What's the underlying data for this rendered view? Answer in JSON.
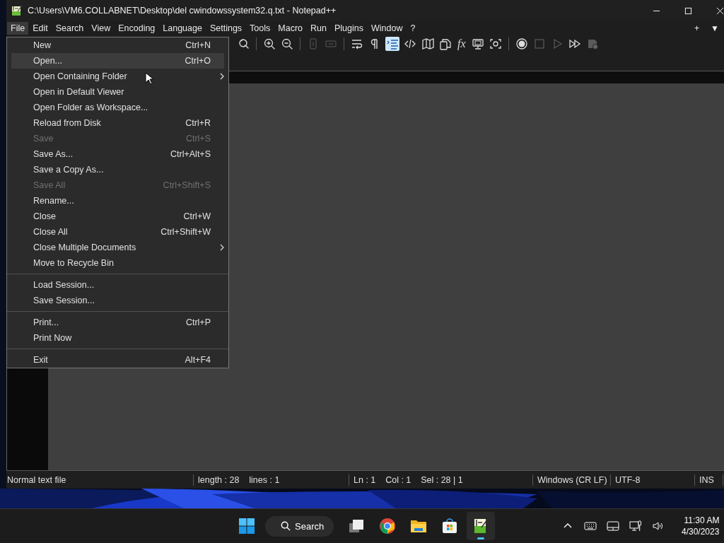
{
  "window": {
    "title": "C:\\Users\\VM6.COLLABNET\\Desktop\\del cwindowssystem32.q.txt - Notepad++"
  },
  "menu_bar": [
    {
      "label": "File",
      "selected": true
    },
    {
      "label": "Edit",
      "selected": false
    },
    {
      "label": "Search",
      "selected": false
    },
    {
      "label": "View",
      "selected": false
    },
    {
      "label": "Encoding",
      "selected": false
    },
    {
      "label": "Language",
      "selected": false
    },
    {
      "label": "Settings",
      "selected": false
    },
    {
      "label": "Tools",
      "selected": false
    },
    {
      "label": "Macro",
      "selected": false
    },
    {
      "label": "Run",
      "selected": false
    },
    {
      "label": "Plugins",
      "selected": false
    },
    {
      "label": "Window",
      "selected": false
    },
    {
      "label": "?",
      "selected": false
    }
  ],
  "menu_bar_right": [
    "+",
    "▼"
  ],
  "toolbar": [
    {
      "kind": "find-replace",
      "disabled": false,
      "on": false
    },
    {
      "kind": "separator"
    },
    {
      "kind": "zoom-in",
      "disabled": false,
      "on": false
    },
    {
      "kind": "zoom-out",
      "disabled": false,
      "on": false
    },
    {
      "kind": "separator"
    },
    {
      "kind": "sync-vertical",
      "disabled": true,
      "on": false
    },
    {
      "kind": "sync-horizontal",
      "disabled": true,
      "on": false
    },
    {
      "kind": "separator"
    },
    {
      "kind": "word-wrap",
      "disabled": false,
      "on": false
    },
    {
      "kind": "all-characters",
      "disabled": false,
      "on": false
    },
    {
      "kind": "indent-guide",
      "disabled": false,
      "on": true
    },
    {
      "kind": "code-tag",
      "disabled": false,
      "on": false
    },
    {
      "kind": "map",
      "disabled": false,
      "on": false
    },
    {
      "kind": "documents",
      "disabled": false,
      "on": false
    },
    {
      "kind": "function-list",
      "glyph": "fx",
      "disabled": false,
      "on": false
    },
    {
      "kind": "monitor",
      "disabled": false,
      "on": false
    },
    {
      "kind": "camera",
      "disabled": false,
      "on": false
    },
    {
      "kind": "separator"
    },
    {
      "kind": "record",
      "disabled": false,
      "on": false
    },
    {
      "kind": "stop",
      "disabled": true,
      "on": false
    },
    {
      "kind": "play",
      "disabled": true,
      "on": false
    },
    {
      "kind": "fast-forward",
      "disabled": false,
      "on": false
    },
    {
      "kind": "save-macro",
      "disabled": true,
      "on": false
    }
  ],
  "file_menu": [
    {
      "kind": "item",
      "label": "New",
      "shortcut": "Ctrl+N",
      "disabled": false,
      "highlighted": false,
      "submenu": false
    },
    {
      "kind": "item",
      "label": "Open...",
      "shortcut": "Ctrl+O",
      "disabled": false,
      "highlighted": true,
      "submenu": false
    },
    {
      "kind": "item",
      "label": "Open Containing Folder",
      "disabled": false,
      "highlighted": false,
      "submenu": true
    },
    {
      "kind": "item",
      "label": "Open in Default Viewer",
      "disabled": false,
      "highlighted": false,
      "submenu": false
    },
    {
      "kind": "item",
      "label": "Open Folder as Workspace...",
      "disabled": false,
      "highlighted": false,
      "submenu": false
    },
    {
      "kind": "item",
      "label": "Reload from Disk",
      "shortcut": "Ctrl+R",
      "disabled": false,
      "highlighted": false,
      "submenu": false
    },
    {
      "kind": "item",
      "label": "Save",
      "shortcut": "Ctrl+S",
      "disabled": true,
      "highlighted": false,
      "submenu": false
    },
    {
      "kind": "item",
      "label": "Save As...",
      "shortcut": "Ctrl+Alt+S",
      "disabled": false,
      "highlighted": false,
      "submenu": false
    },
    {
      "kind": "item",
      "label": "Save a Copy As...",
      "disabled": false,
      "highlighted": false,
      "submenu": false
    },
    {
      "kind": "item",
      "label": "Save All",
      "shortcut": "Ctrl+Shift+S",
      "disabled": true,
      "highlighted": false,
      "submenu": false
    },
    {
      "kind": "item",
      "label": "Rename...",
      "disabled": false,
      "highlighted": false,
      "submenu": false
    },
    {
      "kind": "item",
      "label": "Close",
      "shortcut": "Ctrl+W",
      "disabled": false,
      "highlighted": false,
      "submenu": false
    },
    {
      "kind": "item",
      "label": "Close All",
      "shortcut": "Ctrl+Shift+W",
      "disabled": false,
      "highlighted": false,
      "submenu": false
    },
    {
      "kind": "item",
      "label": "Close Multiple Documents",
      "disabled": false,
      "highlighted": false,
      "submenu": true
    },
    {
      "kind": "item",
      "label": "Move to Recycle Bin",
      "disabled": false,
      "highlighted": false,
      "submenu": false
    },
    {
      "kind": "separator"
    },
    {
      "kind": "item",
      "label": "Load Session...",
      "disabled": false,
      "highlighted": false,
      "submenu": false
    },
    {
      "kind": "item",
      "label": "Save Session...",
      "disabled": false,
      "highlighted": false,
      "submenu": false
    },
    {
      "kind": "separator"
    },
    {
      "kind": "item",
      "label": "Print...",
      "shortcut": "Ctrl+P",
      "disabled": false,
      "highlighted": false,
      "submenu": false
    },
    {
      "kind": "item",
      "label": "Print Now",
      "disabled": false,
      "highlighted": false,
      "submenu": false
    },
    {
      "kind": "separator"
    },
    {
      "kind": "item",
      "label": "Exit",
      "shortcut": "Alt+F4",
      "disabled": false,
      "highlighted": false,
      "submenu": false
    }
  ],
  "status_bar": [
    "Normal text file",
    "length : 28    lines : 1",
    "Ln : 1    Col : 1    Sel : 28 | 1",
    "Windows (CR LF)",
    "UTF-8",
    "INS"
  ],
  "taskbar": {
    "search_label": "Search",
    "apps": [
      {
        "kind": "task-view",
        "active": false
      },
      {
        "kind": "browser",
        "active": false
      },
      {
        "kind": "folder",
        "active": false
      },
      {
        "kind": "store",
        "active": false
      },
      {
        "kind": "notepad",
        "active": true
      }
    ],
    "clock": {
      "time": "11:30 AM",
      "date": "4/30/2023"
    }
  }
}
